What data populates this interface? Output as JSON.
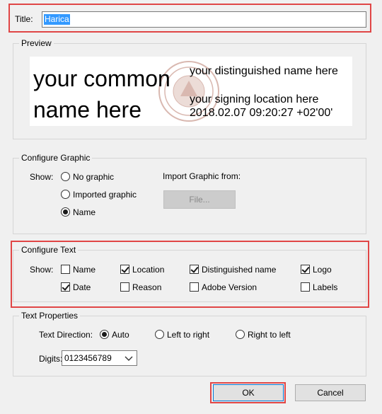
{
  "title_field": {
    "label": "Title:",
    "value": "Harica"
  },
  "preview": {
    "group_label": "Preview",
    "name_text": "your common name here",
    "dn_text": "your distinguished name here",
    "location_text": "your signing location here",
    "date_text": "2018.02.07 09:20:27 +02'00'"
  },
  "configure_graphic": {
    "group_label": "Configure Graphic",
    "show_label": "Show:",
    "options": [
      "No graphic",
      "Imported graphic",
      "Name"
    ],
    "selected": "Name",
    "import_label": "Import Graphic from:",
    "file_button": "File..."
  },
  "configure_text": {
    "group_label": "Configure Text",
    "show_label": "Show:",
    "items": [
      {
        "label": "Name",
        "checked": false
      },
      {
        "label": "Location",
        "checked": true
      },
      {
        "label": "Distinguished name",
        "checked": true
      },
      {
        "label": "Logo",
        "checked": true
      },
      {
        "label": "Date",
        "checked": true
      },
      {
        "label": "Reason",
        "checked": false
      },
      {
        "label": "Adobe Version",
        "checked": false
      },
      {
        "label": "Labels",
        "checked": false
      }
    ]
  },
  "text_properties": {
    "group_label": "Text Properties",
    "direction_label": "Text Direction:",
    "directions": [
      "Auto",
      "Left to right",
      "Right to left"
    ],
    "selected_direction": "Auto",
    "digits_label": "Digits:",
    "digits_value": "0123456789"
  },
  "buttons": {
    "ok": "OK",
    "cancel": "Cancel"
  },
  "colors": {
    "highlight_red": "#e04646",
    "selection_blue": "#3399ff",
    "watermark": "#d9b8b0"
  }
}
